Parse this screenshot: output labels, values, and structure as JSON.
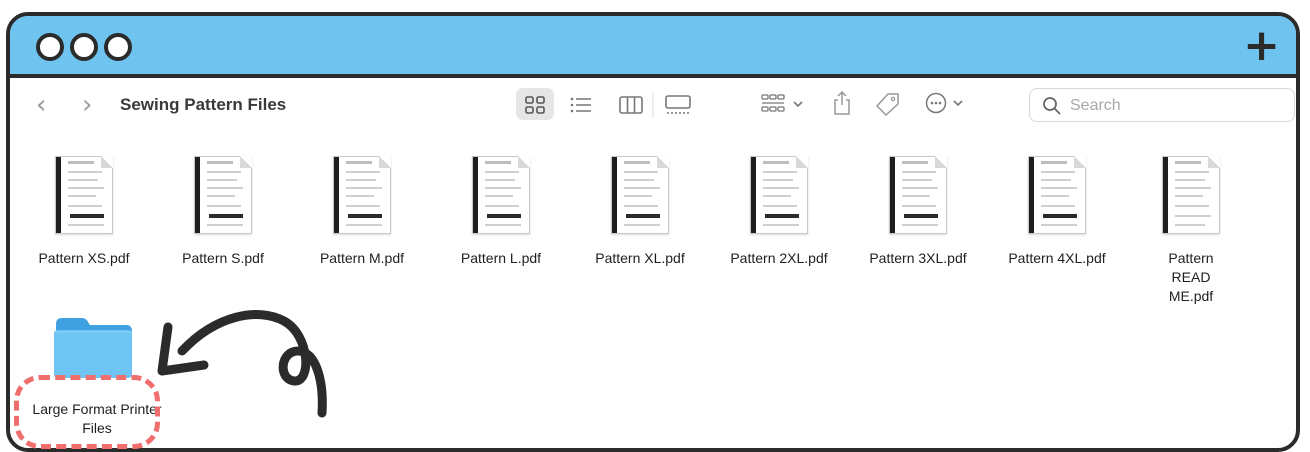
{
  "window": {
    "colors": {
      "titlebar": "#6ec4ef",
      "outline": "#2b2b2b",
      "highlight": "#f06e6e"
    },
    "traffic_lights": [
      "circle-icon",
      "circle-icon",
      "circle-icon"
    ],
    "new_tab_icon": "plus-icon",
    "new_tab_label": "+"
  },
  "toolbar": {
    "back_label": "‹",
    "forward_label": "›",
    "folder_title": "Sewing Pattern Files",
    "view_modes": [
      "icons-view-icon",
      "list-view-icon",
      "columns-view-icon",
      "gallery-view-icon"
    ],
    "selected_view": "icons",
    "group_icon": "group-icon",
    "share_icon": "share-icon",
    "tag_icon": "tag-icon",
    "more_icon": "more-icon",
    "search_placeholder": "Search"
  },
  "files": [
    {
      "name": "Pattern XS.pdf"
    },
    {
      "name": "Pattern S.pdf"
    },
    {
      "name": "Pattern M.pdf"
    },
    {
      "name": "Pattern L.pdf"
    },
    {
      "name": "Pattern XL.pdf"
    },
    {
      "name": "Pattern 2XL.pdf"
    },
    {
      "name": "Pattern 3XL.pdf"
    },
    {
      "name": "Pattern 4XL.pdf"
    },
    {
      "name": "Pattern READ ME.pdf"
    }
  ],
  "folders": [
    {
      "name": "Large Format Printer Files",
      "highlighted": true
    }
  ]
}
